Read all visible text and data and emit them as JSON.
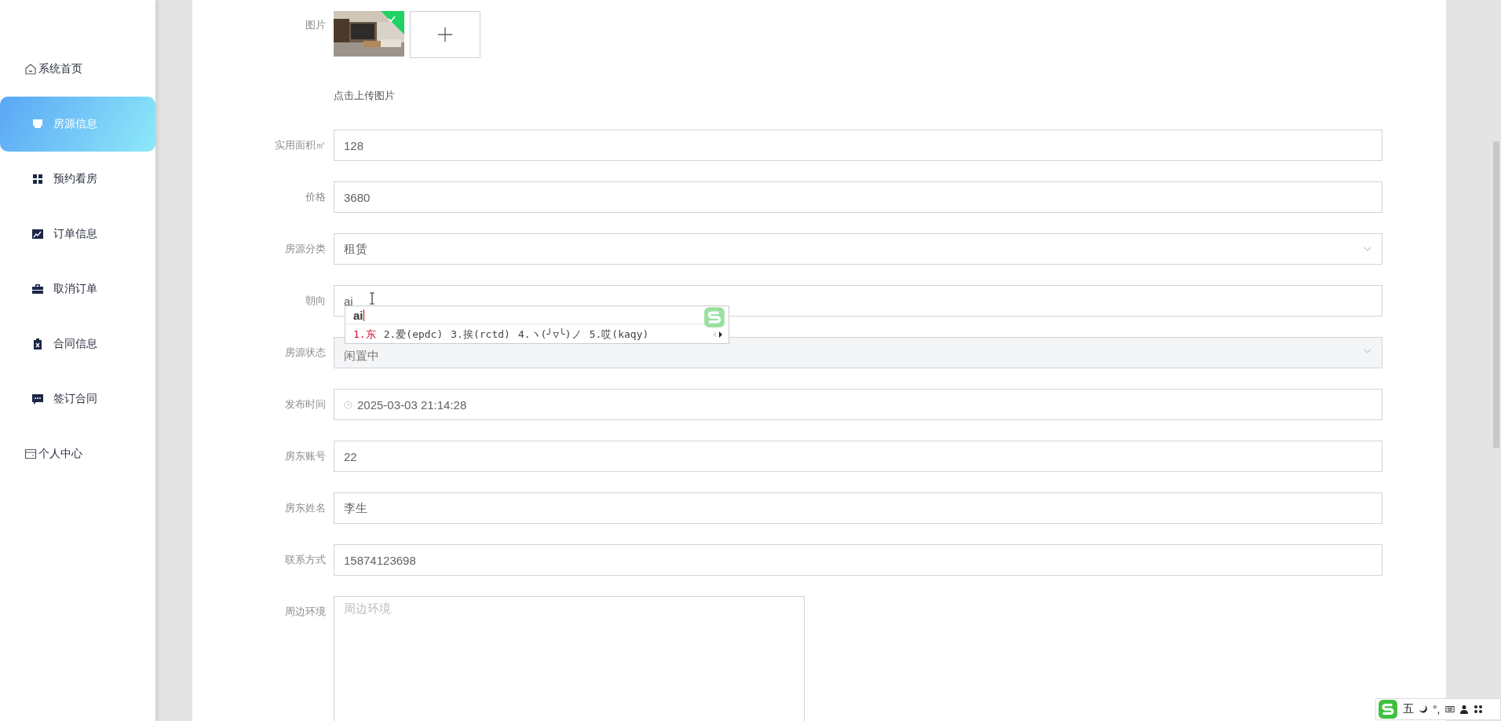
{
  "sidebar": {
    "items": [
      {
        "label": "系统首页",
        "kind": "menu",
        "selected": false
      },
      {
        "label": "房源信息",
        "kind": "submenu",
        "selected": true
      },
      {
        "label": "预约看房",
        "kind": "submenu",
        "selected": false
      },
      {
        "label": "订单信息",
        "kind": "submenu",
        "selected": false
      },
      {
        "label": "取消订单",
        "kind": "submenu",
        "selected": false
      },
      {
        "label": "合同信息",
        "kind": "submenu",
        "selected": false
      },
      {
        "label": "签订合同",
        "kind": "submenu",
        "selected": false
      },
      {
        "label": "个人中心",
        "kind": "menu",
        "selected": false
      }
    ]
  },
  "form": {
    "image": {
      "label": "图片",
      "uploaded": true,
      "hint": "点击上传图片"
    },
    "fields": [
      {
        "label": "实用面积㎡",
        "kind": "input",
        "value": "128",
        "disabled": false
      },
      {
        "label": "价格",
        "kind": "input",
        "value": "3680",
        "disabled": false
      },
      {
        "label": "房源分类",
        "kind": "select",
        "value": "租赁",
        "disabled": false
      },
      {
        "label": "朝向",
        "kind": "input",
        "value": "ai",
        "disabled": false
      },
      {
        "label": "房源状态",
        "kind": "select",
        "value": "闲置中",
        "disabled": true
      },
      {
        "label": "发布时间",
        "kind": "date",
        "value": "2025-03-03 21:14:28",
        "disabled": false
      },
      {
        "label": "房东账号",
        "kind": "input",
        "value": "22",
        "disabled": false
      },
      {
        "label": "房东姓名",
        "kind": "input",
        "value": "李生",
        "disabled": false
      },
      {
        "label": "联系方式",
        "kind": "input",
        "value": "15874123698",
        "disabled": false
      },
      {
        "label": "周边环境",
        "kind": "textarea",
        "placeholder": "周边环境"
      }
    ]
  },
  "ime": {
    "composition": "ai",
    "candidates": [
      {
        "text": "1.东",
        "selected": true
      },
      {
        "text": "2.爱(epdc)",
        "selected": false
      },
      {
        "text": "3.挨(rctd)",
        "selected": false
      },
      {
        "text": "4.ヽ(╯▽╰)ノ",
        "selected": false
      },
      {
        "text": "5.哎(kaqy)",
        "selected": false
      }
    ]
  },
  "ime_toolbar": {
    "mode": "五",
    "punctuation": "°,"
  }
}
